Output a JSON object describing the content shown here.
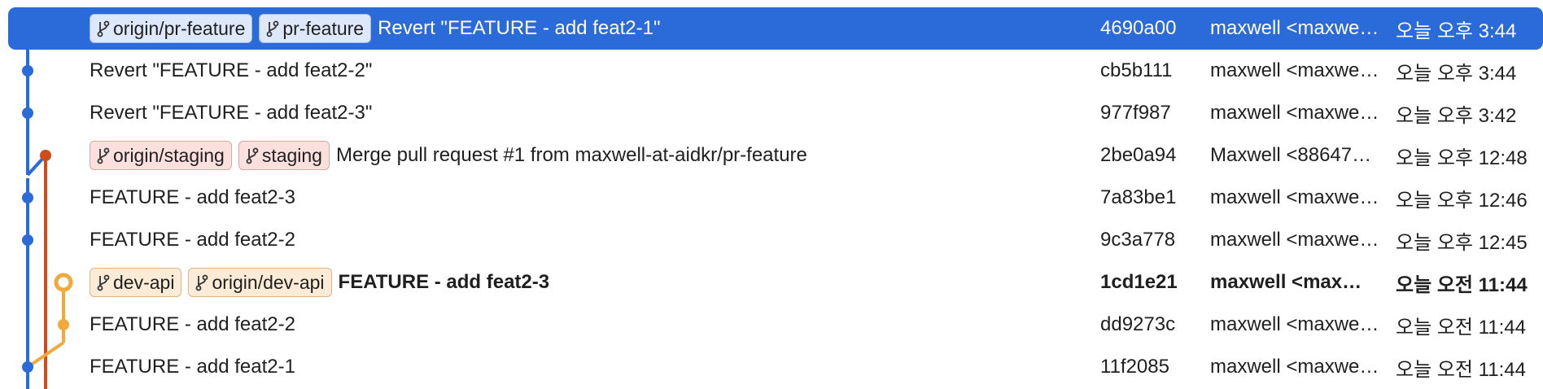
{
  "colors": {
    "selected_bg": "#2a6ad9",
    "lane_blue": "#2a6ad9",
    "lane_red": "#cc4c1c",
    "lane_orange": "#f2a93b"
  },
  "commits": [
    {
      "tags": [
        {
          "label": "origin/pr-feature",
          "color": "blue",
          "icon": "branch-icon"
        },
        {
          "label": "pr-feature",
          "color": "blue",
          "icon": "branch-icon"
        }
      ],
      "message": "Revert \"FEATURE - add feat2-1\"",
      "hash": "4690a00",
      "author": "maxwell <maxwe…",
      "date": "오늘 오후 3:44",
      "selected": true,
      "bold": false
    },
    {
      "tags": [],
      "message": "Revert \"FEATURE - add feat2-2\"",
      "hash": "cb5b111",
      "author": "maxwell <maxwe…",
      "date": "오늘 오후 3:44",
      "selected": false,
      "bold": false
    },
    {
      "tags": [],
      "message": "Revert \"FEATURE - add feat2-3\"",
      "hash": "977f987",
      "author": "maxwell <maxwe…",
      "date": "오늘 오후 3:42",
      "selected": false,
      "bold": false
    },
    {
      "tags": [
        {
          "label": "origin/staging",
          "color": "red",
          "icon": "branch-icon"
        },
        {
          "label": "staging",
          "color": "red",
          "icon": "branch-icon"
        }
      ],
      "message": "Merge pull request #1 from maxwell-at-aidkr/pr-feature",
      "hash": "2be0a94",
      "author": "Maxwell <88647…",
      "date": "오늘 오후 12:48",
      "selected": false,
      "bold": false
    },
    {
      "tags": [],
      "message": "FEATURE - add feat2-3",
      "hash": "7a83be1",
      "author": "maxwell <maxwe…",
      "date": "오늘 오후 12:46",
      "selected": false,
      "bold": false
    },
    {
      "tags": [],
      "message": "FEATURE - add feat2-2",
      "hash": "9c3a778",
      "author": "maxwell <maxwe…",
      "date": "오늘 오후 12:45",
      "selected": false,
      "bold": false
    },
    {
      "tags": [
        {
          "label": "dev-api",
          "color": "orange",
          "icon": "branch-icon"
        },
        {
          "label": "origin/dev-api",
          "color": "orange",
          "icon": "branch-icon"
        }
      ],
      "message": "FEATURE - add feat2-3",
      "hash": "1cd1e21",
      "author": "maxwell <max…",
      "date": "오늘 오전 11:44",
      "selected": false,
      "bold": true
    },
    {
      "tags": [],
      "message": "FEATURE - add feat2-2",
      "hash": "dd9273c",
      "author": "maxwell <maxwe…",
      "date": "오늘 오전 11:44",
      "selected": false,
      "bold": false
    },
    {
      "tags": [],
      "message": "FEATURE - add feat2-1",
      "hash": "11f2085",
      "author": "maxwell <maxwe…",
      "date": "오늘 오전 11:44",
      "selected": false,
      "bold": false
    }
  ]
}
